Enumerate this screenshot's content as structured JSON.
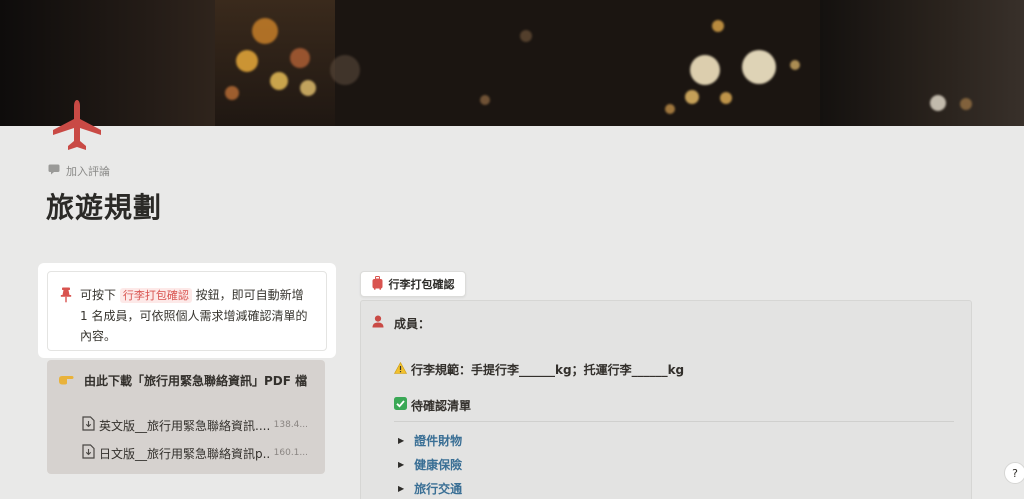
{
  "page": {
    "title": "旅遊規劃",
    "add_comment": "加入評論",
    "icon": "airplane-icon",
    "accent_color": "#d9534f"
  },
  "callout": {
    "icon": "pushpin-icon",
    "text_before": "可按下",
    "tag": "行李打包確認",
    "text_after": "按鈕，即可自動新增 1 名成員，可依照個人需求增減確認清單的內容。"
  },
  "download": {
    "icon": "pointing-hand-icon",
    "heading": "由此下載「旅行用緊急聯絡資訊」PDF 檔",
    "files": [
      {
        "name": "英文版__旅行用緊急聯絡資訊....",
        "size": "138.4..."
      },
      {
        "name": "日文版__旅行用緊急聯絡資訊p...",
        "size": "160.1..."
      }
    ]
  },
  "button": {
    "label": "行李打包確認",
    "icon": "luggage-icon"
  },
  "checklist": {
    "member_label": "成員：",
    "member_icon": "person-icon",
    "rule_icon": "warning-icon",
    "rule_text": "行李規範：手提行李______kg；托運行李______kg",
    "todo_icon": "check-box-icon",
    "todo_label": "待確認清單",
    "toggles": [
      "證件財物",
      "健康保險",
      "旅行交通"
    ]
  },
  "help": {
    "label": "?"
  }
}
